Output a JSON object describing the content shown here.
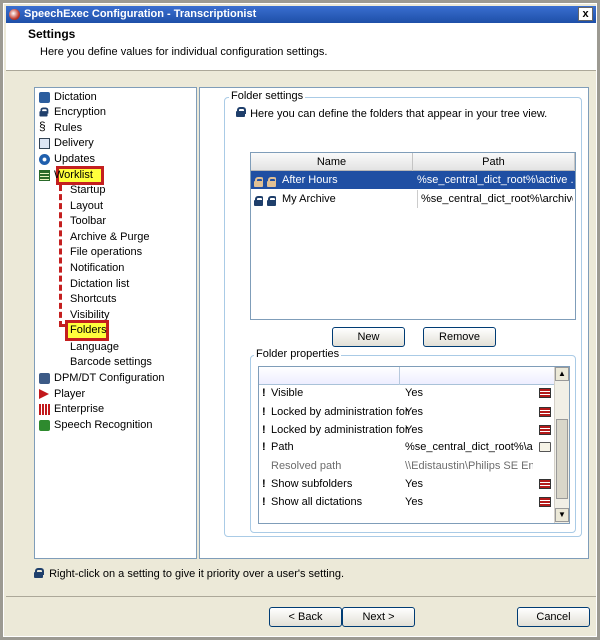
{
  "window": {
    "title": "SpeechExec Configuration - Transcriptionist",
    "close": "x"
  },
  "header": {
    "title": "Settings",
    "description": "Here you define values for individual configuration settings."
  },
  "tree": {
    "items": [
      {
        "label": "Dictation",
        "icon": "dictation-icon"
      },
      {
        "label": "Encryption",
        "icon": "encryption-icon"
      },
      {
        "label": "Rules",
        "icon": "rules-icon"
      },
      {
        "label": "Delivery",
        "icon": "delivery-icon"
      },
      {
        "label": "Updates",
        "icon": "updates-icon"
      },
      {
        "label": "Worklist",
        "icon": "worklist-icon"
      }
    ],
    "worklist_children": [
      "Startup",
      "Layout",
      "Toolbar",
      "Archive & Purge",
      "File operations",
      "Notification",
      "Dictation list",
      "Shortcuts",
      "Visibility",
      "Folders",
      "Language",
      "Barcode settings"
    ],
    "items_after": [
      {
        "label": "DPM/DT Configuration",
        "icon": "dpm-icon"
      },
      {
        "label": "Player",
        "icon": "player-icon"
      },
      {
        "label": "Enterprise",
        "icon": "enterprise-icon"
      },
      {
        "label": "Speech Recognition",
        "icon": "speech-recognition-icon"
      }
    ]
  },
  "folder_settings": {
    "title": "Folder settings",
    "hint": "Here you can define the folders that appear in your tree view.",
    "columns": [
      "Name",
      "Path"
    ],
    "rows": [
      {
        "name": "After Hours",
        "path": "%se_central_dict_root%\\active ...\\"
      },
      {
        "name": "My Archive",
        "path": "%se_central_dict_root%\\archive...\\"
      }
    ],
    "new_button": "New",
    "remove_button": "Remove"
  },
  "folder_properties": {
    "title": "Folder properties",
    "rows": [
      {
        "bang": "!",
        "name": "Visible",
        "value": "Yes",
        "icon": "list-icon"
      },
      {
        "bang": "!",
        "name": "Locked by administration for",
        "value": "Yes",
        "icon": "list-icon"
      },
      {
        "bang": "!",
        "name": "Locked by administration for",
        "value": "Yes",
        "icon": "list-icon"
      },
      {
        "bang": "!",
        "name": "Path",
        "value": "%se_central_dict_root%\\a...\\",
        "icon": "folder-icon"
      },
      {
        "bang": "",
        "name": "Resolved path",
        "value": "\\\\Edistaustin\\Philips SE Enter",
        "icon": ""
      },
      {
        "bang": "!",
        "name": "Show subfolders",
        "value": "Yes",
        "icon": "list-icon"
      },
      {
        "bang": "!",
        "name": "Show all dictations",
        "value": "Yes",
        "icon": "list-icon"
      }
    ]
  },
  "footer": {
    "note": "Right-click on a setting to give it priority over a user's setting.",
    "back": "< Back",
    "next": "Next >",
    "cancel": "Cancel"
  },
  "colors": {
    "highlight_border": "#c41f1f",
    "highlight_fill": "#ffff3c",
    "selection": "#1f4fa3"
  }
}
